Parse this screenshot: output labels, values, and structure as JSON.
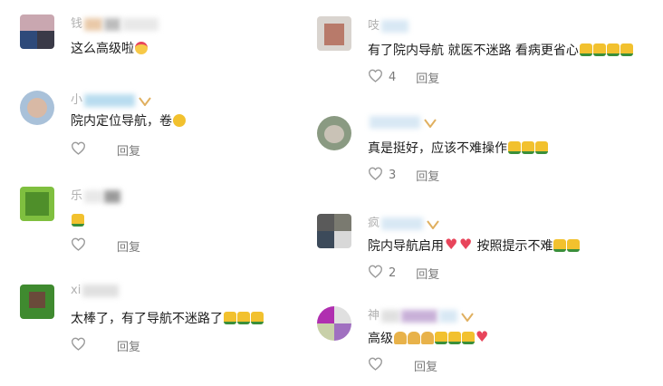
{
  "reply_label": "回复",
  "colors": {
    "like_icon": "#9a9a9a",
    "text": "#1c1c1c",
    "meta": "#7a7a7a",
    "username": "#b0b0b0"
  },
  "left_column": [
    {
      "username": "钱",
      "text": "这么高级啦",
      "emojis": [
        "party-face"
      ],
      "likes": ""
    },
    {
      "username": "小",
      "text": "院内定位导航，卷",
      "emojis": [
        "grin-face"
      ],
      "likes": ""
    },
    {
      "username": "乐",
      "text": "",
      "emojis": [
        "thumbs-up"
      ],
      "likes": ""
    },
    {
      "username": "xi",
      "text": "太棒了，有了导航不迷路了",
      "emojis": [
        "thumbs-up",
        "thumbs-up",
        "thumbs-up"
      ],
      "likes": ""
    }
  ],
  "right_column": [
    {
      "username": "吱",
      "text": "有了院内导航 就医不迷路 看病更省心",
      "emojis": [
        "thumbs-up",
        "thumbs-up",
        "thumbs-up",
        "thumbs-up"
      ],
      "likes": "4"
    },
    {
      "username": "",
      "text": "真是挺好，应该不难操作",
      "emojis": [
        "thumbs-up",
        "thumbs-up",
        "thumbs-up"
      ],
      "likes": "3"
    },
    {
      "username": "疯",
      "text_before": "院内导航启用",
      "emojis_mid": [
        "red-heart",
        "red-heart"
      ],
      "text_after": " 按照提示不难",
      "emojis": [
        "thumbs-up",
        "thumbs-up"
      ],
      "likes": "2"
    },
    {
      "username": "神",
      "text": "高级",
      "emojis": [
        "folded-hands",
        "folded-hands",
        "folded-hands",
        "thumbs-up",
        "thumbs-up",
        "thumbs-up",
        "red-heart"
      ],
      "likes": ""
    }
  ]
}
